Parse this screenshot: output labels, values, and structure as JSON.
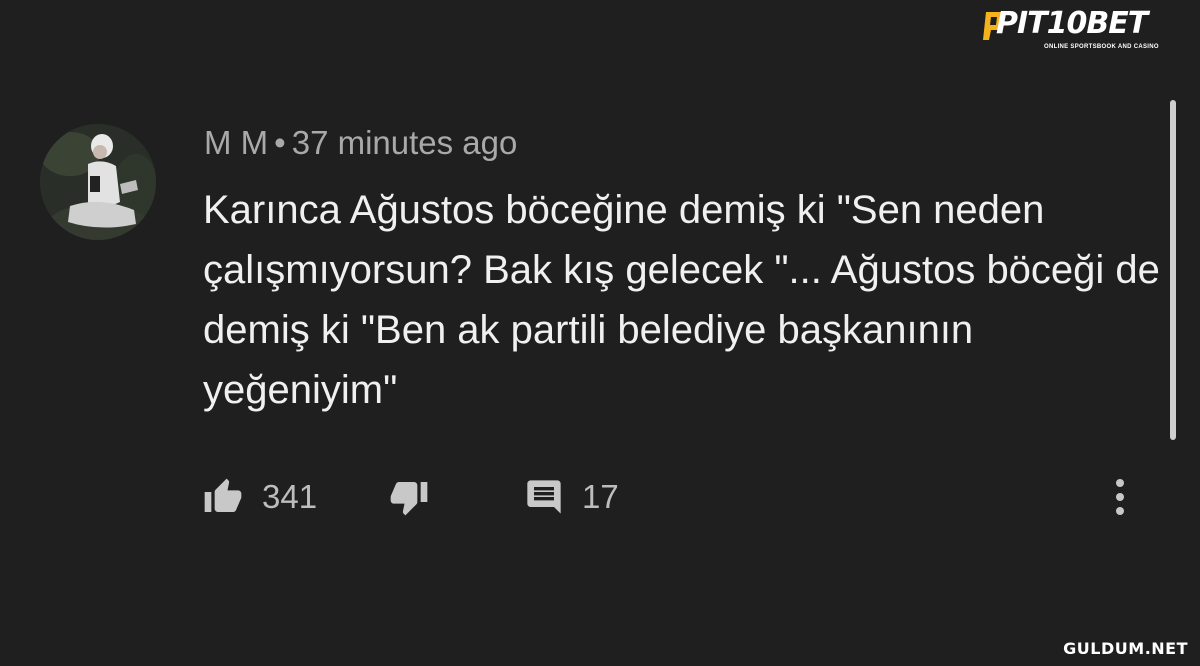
{
  "brand": {
    "name": "PIT10BET",
    "tagline": "ONLINE SPORTSBOOK AND CASINO"
  },
  "comment": {
    "author": "M M",
    "separator": "•",
    "time": "37 minutes ago",
    "text": "Karınca Ağustos böceğine demiş ki \"Sen neden çalışmıyorsun? Bak kış gelecek \"... Ağustos böceği de demiş ki \"Ben ak partili belediye başkanının yeğeniyim\"",
    "likes": "341",
    "replies": "17"
  },
  "icons": {
    "like": "thumbs-up-icon",
    "dislike": "thumbs-down-icon",
    "reply": "comment-icon",
    "more": "more-vertical-icon"
  },
  "watermark": "GULDUM.NET",
  "colors": {
    "background": "#1f1f1f",
    "text": "#f0f0f0",
    "meta": "#a9a9a9",
    "brand_accent": "#f5b21a"
  }
}
